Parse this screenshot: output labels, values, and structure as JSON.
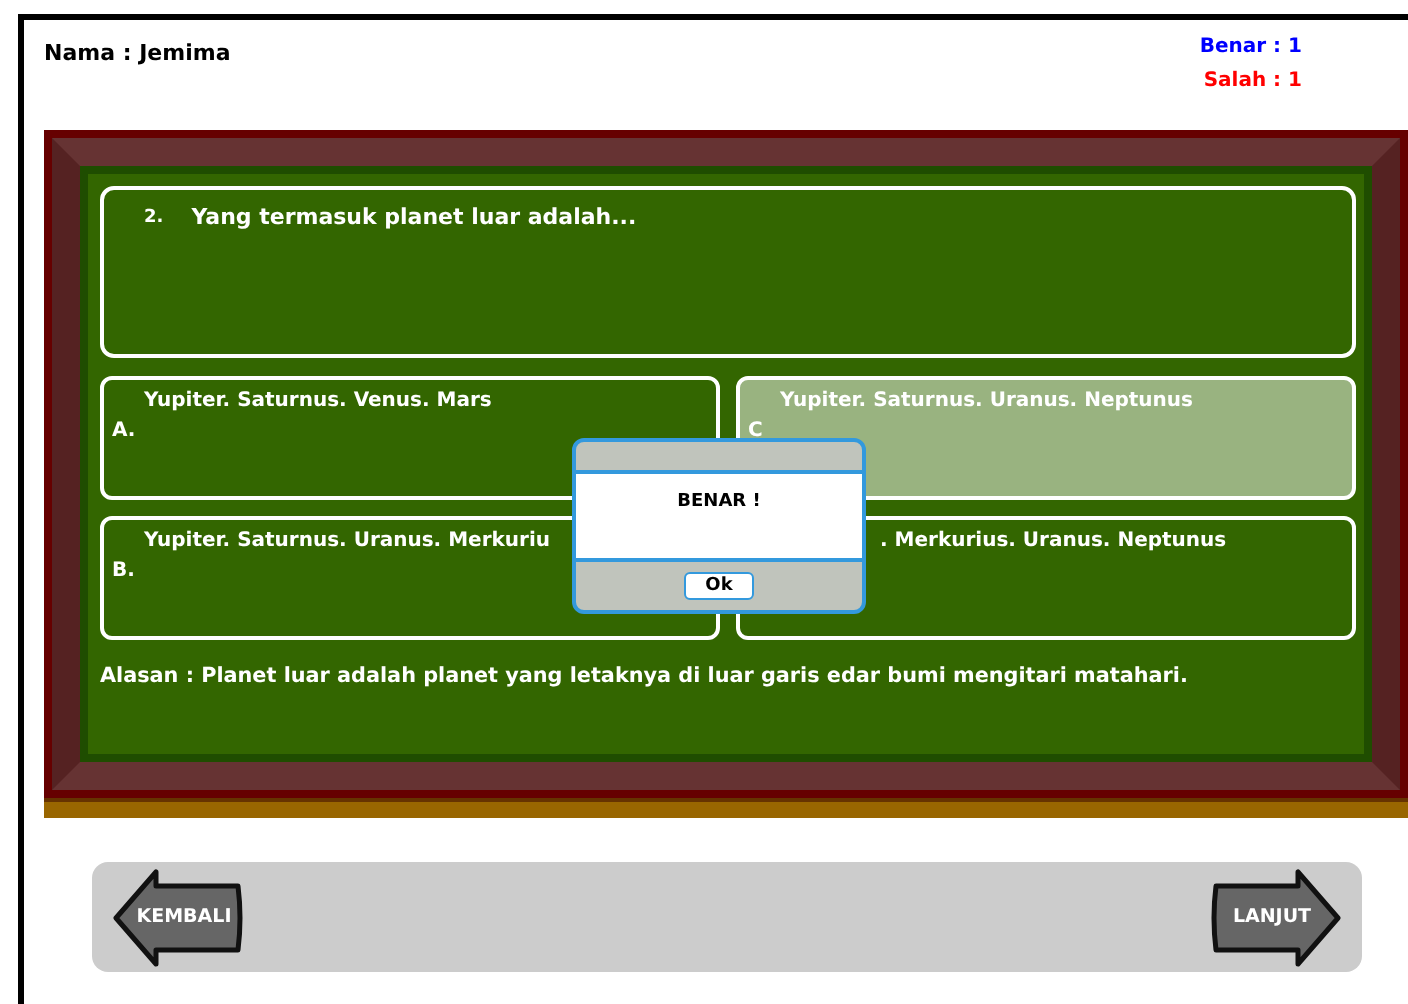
{
  "student": {
    "name_label": "Nama : Jemima"
  },
  "score": [
    {
      "text": "Benar : 1",
      "color": "#0000ff"
    },
    {
      "text": "Salah : 1",
      "color": "#ff0000"
    }
  ],
  "question": {
    "number": "2.",
    "text": "Yang termasuk planet luar adalah..."
  },
  "options": [
    {
      "label": "A.",
      "text": "Yupiter. Saturnus. Venus. Mars",
      "selected": false
    },
    {
      "label": "C",
      "text": "Yupiter. Saturnus. Uranus. Neptunus",
      "selected": true
    },
    {
      "label": "B.",
      "text": "Yupiter. Saturnus. Uranus. Merkuriu",
      "selected": false
    },
    {
      "text": ". Merkurius. Uranus. Neptunus",
      "selected": false
    }
  ],
  "reason": "Alasan : Planet luar adalah planet yang letaknya di luar garis edar bumi mengitari matahari.",
  "dialog": {
    "message": "BENAR !",
    "button": "Ok"
  },
  "nav": {
    "back": "KEMBALI",
    "next": "LANJUT"
  }
}
